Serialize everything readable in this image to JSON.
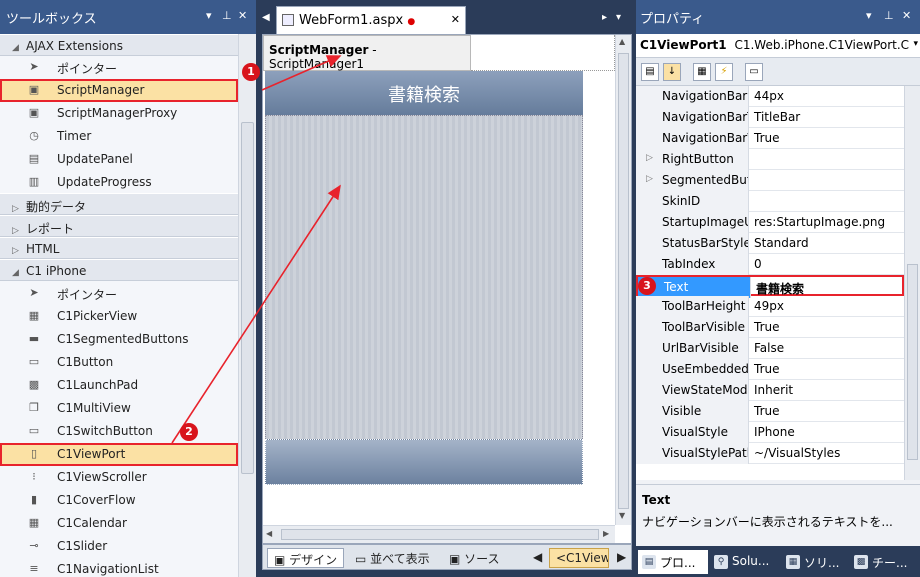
{
  "toolbox": {
    "title": "ツールボックス",
    "groups": {
      "ajax": "AJAX Extensions",
      "dynamic": "動的データ",
      "report": "レポート",
      "html": "HTML",
      "c1iphone": "C1 iPhone"
    },
    "ajax_items": [
      "ポインター",
      "ScriptManager",
      "ScriptManagerProxy",
      "Timer",
      "UpdatePanel",
      "UpdateProgress"
    ],
    "c1_items": [
      "ポインター",
      "C1PickerView",
      "C1SegmentedButtons",
      "C1Button",
      "C1LaunchPad",
      "C1MultiView",
      "C1SwitchButton",
      "C1ViewPort",
      "C1ViewScroller",
      "C1CoverFlow",
      "C1Calendar",
      "C1Slider",
      "C1NavigationList"
    ]
  },
  "editor": {
    "tab_label": "WebForm1.aspx",
    "sm_label_bold": "ScriptManager",
    "sm_label_rest": " - ScriptManager1",
    "viewport_title": "書籍検索",
    "footer": {
      "design": "デザイン",
      "split": "並べて表示",
      "source": "ソース",
      "path": "<C1View"
    }
  },
  "properties": {
    "title": "プロパティ",
    "object_name": "C1ViewPort1",
    "object_type": "C1.Web.iPhone.C1ViewPort.C",
    "rows": [
      {
        "name": "NavigationBarH",
        "value": "44px"
      },
      {
        "name": "NavigationBarT",
        "value": "TitleBar"
      },
      {
        "name": "NavigationBarV",
        "value": "True"
      },
      {
        "name": "RightButton",
        "value": ""
      },
      {
        "name": "SegmentedButt",
        "value": ""
      },
      {
        "name": "SkinID",
        "value": ""
      },
      {
        "name": "StartupImageUr",
        "value": "res:StartupImage.png"
      },
      {
        "name": "StatusBarStyle",
        "value": "Standard"
      },
      {
        "name": "TabIndex",
        "value": "0"
      },
      {
        "name": "Text",
        "value": "書籍検索"
      },
      {
        "name": "ToolBarHeight",
        "value": "49px"
      },
      {
        "name": "ToolBarVisible",
        "value": "True"
      },
      {
        "name": "UrlBarVisible",
        "value": "False"
      },
      {
        "name": "UseEmbeddedV",
        "value": "True"
      },
      {
        "name": "ViewStateMode",
        "value": "Inherit"
      },
      {
        "name": "Visible",
        "value": "True"
      },
      {
        "name": "VisualStyle",
        "value": "IPhone"
      },
      {
        "name": "VisualStylePath",
        "value": "~/VisualStyles"
      }
    ],
    "desc_title": "Text",
    "desc_text": "ナビゲーションバーに表示されるテキストを...",
    "tabs": [
      "プロ...",
      "Solu...",
      "ソリ...",
      "チー..."
    ]
  },
  "annotations": {
    "m1": "1",
    "m2": "2",
    "m3": "3"
  },
  "colors": {
    "highlight_red": "#e8232c",
    "panel_title": "#3a5a8c",
    "selected_row": "#3399ff"
  }
}
